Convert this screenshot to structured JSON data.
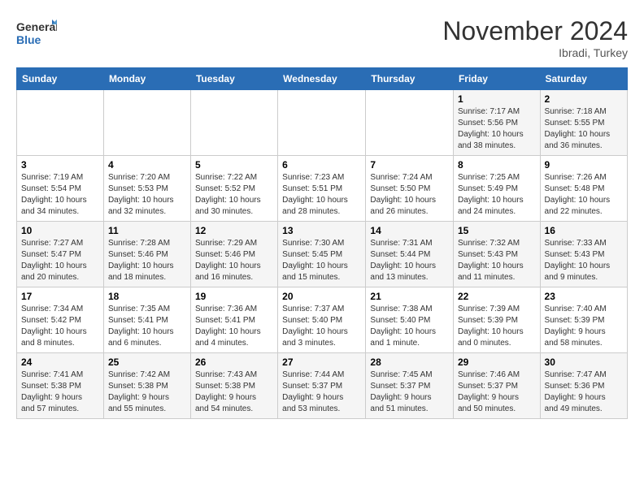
{
  "logo": {
    "general": "General",
    "blue": "Blue"
  },
  "header": {
    "month": "November 2024",
    "location": "Ibradi, Turkey"
  },
  "weekdays": [
    "Sunday",
    "Monday",
    "Tuesday",
    "Wednesday",
    "Thursday",
    "Friday",
    "Saturday"
  ],
  "weeks": [
    [
      {
        "day": "",
        "info": ""
      },
      {
        "day": "",
        "info": ""
      },
      {
        "day": "",
        "info": ""
      },
      {
        "day": "",
        "info": ""
      },
      {
        "day": "",
        "info": ""
      },
      {
        "day": "1",
        "info": "Sunrise: 7:17 AM\nSunset: 5:56 PM\nDaylight: 10 hours\nand 38 minutes."
      },
      {
        "day": "2",
        "info": "Sunrise: 7:18 AM\nSunset: 5:55 PM\nDaylight: 10 hours\nand 36 minutes."
      }
    ],
    [
      {
        "day": "3",
        "info": "Sunrise: 7:19 AM\nSunset: 5:54 PM\nDaylight: 10 hours\nand 34 minutes."
      },
      {
        "day": "4",
        "info": "Sunrise: 7:20 AM\nSunset: 5:53 PM\nDaylight: 10 hours\nand 32 minutes."
      },
      {
        "day": "5",
        "info": "Sunrise: 7:22 AM\nSunset: 5:52 PM\nDaylight: 10 hours\nand 30 minutes."
      },
      {
        "day": "6",
        "info": "Sunrise: 7:23 AM\nSunset: 5:51 PM\nDaylight: 10 hours\nand 28 minutes."
      },
      {
        "day": "7",
        "info": "Sunrise: 7:24 AM\nSunset: 5:50 PM\nDaylight: 10 hours\nand 26 minutes."
      },
      {
        "day": "8",
        "info": "Sunrise: 7:25 AM\nSunset: 5:49 PM\nDaylight: 10 hours\nand 24 minutes."
      },
      {
        "day": "9",
        "info": "Sunrise: 7:26 AM\nSunset: 5:48 PM\nDaylight: 10 hours\nand 22 minutes."
      }
    ],
    [
      {
        "day": "10",
        "info": "Sunrise: 7:27 AM\nSunset: 5:47 PM\nDaylight: 10 hours\nand 20 minutes."
      },
      {
        "day": "11",
        "info": "Sunrise: 7:28 AM\nSunset: 5:46 PM\nDaylight: 10 hours\nand 18 minutes."
      },
      {
        "day": "12",
        "info": "Sunrise: 7:29 AM\nSunset: 5:46 PM\nDaylight: 10 hours\nand 16 minutes."
      },
      {
        "day": "13",
        "info": "Sunrise: 7:30 AM\nSunset: 5:45 PM\nDaylight: 10 hours\nand 15 minutes."
      },
      {
        "day": "14",
        "info": "Sunrise: 7:31 AM\nSunset: 5:44 PM\nDaylight: 10 hours\nand 13 minutes."
      },
      {
        "day": "15",
        "info": "Sunrise: 7:32 AM\nSunset: 5:43 PM\nDaylight: 10 hours\nand 11 minutes."
      },
      {
        "day": "16",
        "info": "Sunrise: 7:33 AM\nSunset: 5:43 PM\nDaylight: 10 hours\nand 9 minutes."
      }
    ],
    [
      {
        "day": "17",
        "info": "Sunrise: 7:34 AM\nSunset: 5:42 PM\nDaylight: 10 hours\nand 8 minutes."
      },
      {
        "day": "18",
        "info": "Sunrise: 7:35 AM\nSunset: 5:41 PM\nDaylight: 10 hours\nand 6 minutes."
      },
      {
        "day": "19",
        "info": "Sunrise: 7:36 AM\nSunset: 5:41 PM\nDaylight: 10 hours\nand 4 minutes."
      },
      {
        "day": "20",
        "info": "Sunrise: 7:37 AM\nSunset: 5:40 PM\nDaylight: 10 hours\nand 3 minutes."
      },
      {
        "day": "21",
        "info": "Sunrise: 7:38 AM\nSunset: 5:40 PM\nDaylight: 10 hours\nand 1 minute."
      },
      {
        "day": "22",
        "info": "Sunrise: 7:39 AM\nSunset: 5:39 PM\nDaylight: 10 hours\nand 0 minutes."
      },
      {
        "day": "23",
        "info": "Sunrise: 7:40 AM\nSunset: 5:39 PM\nDaylight: 9 hours\nand 58 minutes."
      }
    ],
    [
      {
        "day": "24",
        "info": "Sunrise: 7:41 AM\nSunset: 5:38 PM\nDaylight: 9 hours\nand 57 minutes."
      },
      {
        "day": "25",
        "info": "Sunrise: 7:42 AM\nSunset: 5:38 PM\nDaylight: 9 hours\nand 55 minutes."
      },
      {
        "day": "26",
        "info": "Sunrise: 7:43 AM\nSunset: 5:38 PM\nDaylight: 9 hours\nand 54 minutes."
      },
      {
        "day": "27",
        "info": "Sunrise: 7:44 AM\nSunset: 5:37 PM\nDaylight: 9 hours\nand 53 minutes."
      },
      {
        "day": "28",
        "info": "Sunrise: 7:45 AM\nSunset: 5:37 PM\nDaylight: 9 hours\nand 51 minutes."
      },
      {
        "day": "29",
        "info": "Sunrise: 7:46 AM\nSunset: 5:37 PM\nDaylight: 9 hours\nand 50 minutes."
      },
      {
        "day": "30",
        "info": "Sunrise: 7:47 AM\nSunset: 5:36 PM\nDaylight: 9 hours\nand 49 minutes."
      }
    ]
  ]
}
